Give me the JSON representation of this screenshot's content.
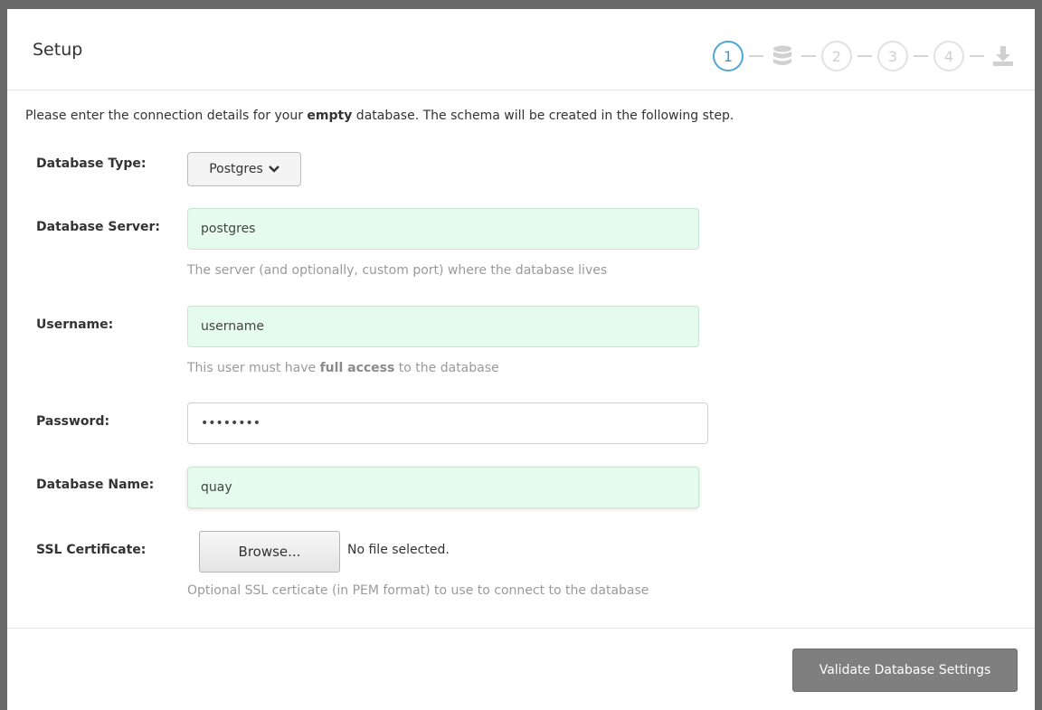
{
  "header": {
    "title": "Setup",
    "steps": [
      {
        "label": "1",
        "icon": null,
        "state": "active"
      },
      {
        "label": "",
        "icon": "database-icon",
        "state": "pending"
      },
      {
        "label": "2",
        "icon": null,
        "state": "pending"
      },
      {
        "label": "3",
        "icon": null,
        "state": "pending"
      },
      {
        "label": "4",
        "icon": null,
        "state": "pending"
      },
      {
        "label": "",
        "icon": "download-icon",
        "state": "pending"
      }
    ]
  },
  "intro": {
    "before": "Please enter the connection details for your ",
    "bold": "empty",
    "after": " database. The schema will be created in the following step."
  },
  "form": {
    "db_type_label": "Database Type:",
    "db_type_value": "Postgres",
    "server_label": "Database Server:",
    "server_value": "postgres",
    "server_help": "The server (and optionally, custom port) where the database lives",
    "username_label": "Username:",
    "username_value": "username",
    "username_help_before": "This user must have ",
    "username_help_bold": "full access",
    "username_help_after": " to the database",
    "password_label": "Password:",
    "password_value": "••••••••",
    "dbname_label": "Database Name:",
    "dbname_value": "quay",
    "ssl_label": "SSL Certificate:",
    "ssl_browse": "Browse...",
    "ssl_status": "No file selected.",
    "ssl_help": "Optional SSL certicate (in PEM format) to use to connect to the database"
  },
  "footer": {
    "validate_label": "Validate Database Settings"
  },
  "colors": {
    "active_step": "#4ea6d6",
    "valid_field_bg": "#e5fbed",
    "validate_button": "#7f7f7f"
  }
}
